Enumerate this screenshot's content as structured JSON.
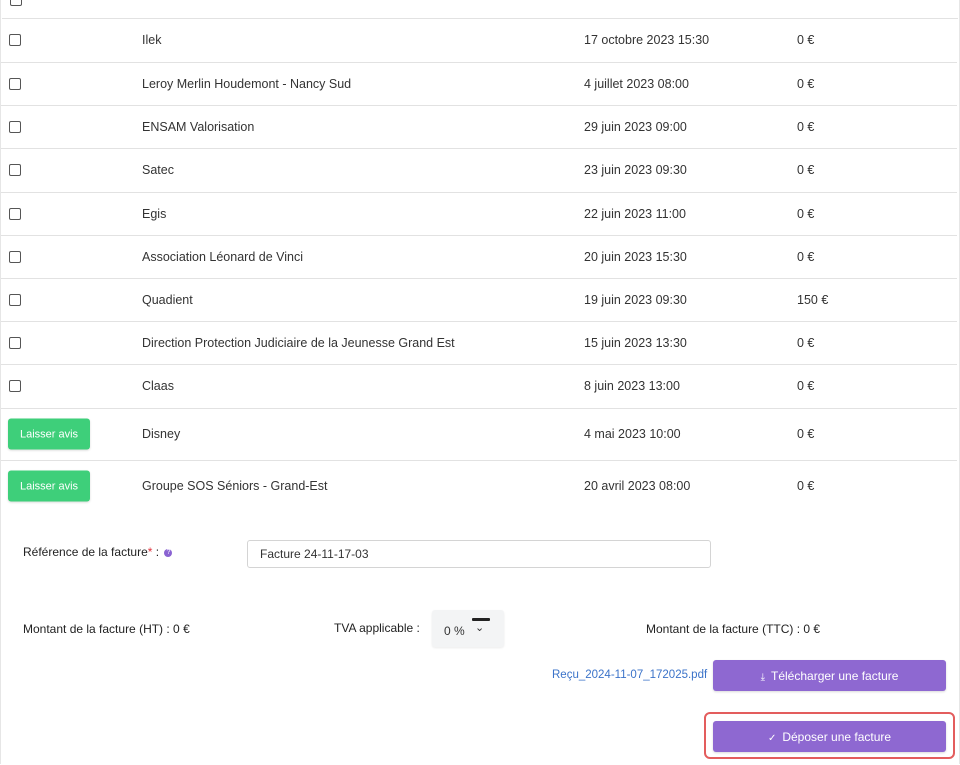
{
  "table": {
    "rows": [
      {
        "type": "checkbox",
        "company": "Ilek",
        "date": "17 octobre 2023 15:30",
        "amount": "0 €"
      },
      {
        "type": "checkbox",
        "company": "Leroy Merlin Houdemont - Nancy Sud",
        "date": "4 juillet 2023 08:00",
        "amount": "0 €"
      },
      {
        "type": "checkbox",
        "company": "ENSAM Valorisation",
        "date": "29 juin 2023 09:00",
        "amount": "0 €"
      },
      {
        "type": "checkbox",
        "company": "Satec",
        "date": "23 juin 2023 09:30",
        "amount": "0 €"
      },
      {
        "type": "checkbox",
        "company": "Egis",
        "date": "22 juin 2023 11:00",
        "amount": "0 €"
      },
      {
        "type": "checkbox",
        "company": "Association Léonard de Vinci",
        "date": "20 juin 2023 15:30",
        "amount": "0 €"
      },
      {
        "type": "checkbox",
        "company": "Quadient",
        "date": "19 juin 2023 09:30",
        "amount": "150 €"
      },
      {
        "type": "checkbox",
        "company": "Direction Protection Judiciaire de la Jeunesse Grand Est",
        "date": "15 juin 2023 13:30",
        "amount": "0 €"
      },
      {
        "type": "checkbox",
        "company": "Claas",
        "date": "8 juin 2023 13:00",
        "amount": "0 €"
      },
      {
        "type": "button",
        "button_label": "Laisser avis",
        "company": "Disney",
        "date": "4 mai 2023 10:00",
        "amount": "0 €"
      },
      {
        "type": "button",
        "button_label": "Laisser avis",
        "company": "Groupe SOS Séniors - Grand-Est",
        "date": "20 avril 2023 08:00",
        "amount": "0 €"
      }
    ]
  },
  "invoice": {
    "reference_label": "Référence de la facture",
    "reference_required_mark": "*",
    "reference_suffix": " :",
    "help_icon": "question-circle-icon",
    "reference_value": "Facture 24-11-17-03",
    "amount_ht_label": "Montant de la facture (HT) : 0 €",
    "tva_label": "TVA applicable :",
    "tva_value": "0 %",
    "amount_ttc_label": "Montant de la facture (TTC) : 0 €",
    "receipt_link": "Reçu_2024-11-07_172025.pdf",
    "download_button": "Télécharger une facture",
    "submit_button": "Déposer une facture"
  },
  "colors": {
    "green_button": "#3ecf7a",
    "purple_button": "#8e68d1",
    "highlight": "#e35d5d",
    "link": "#3b73c9"
  }
}
